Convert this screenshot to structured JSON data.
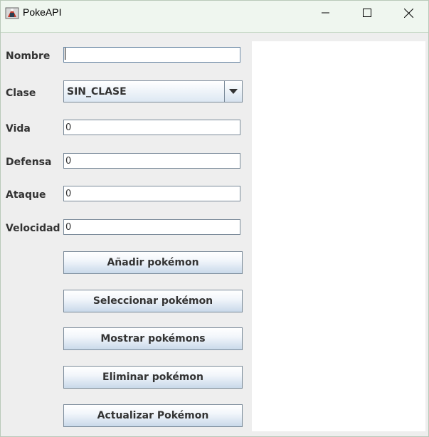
{
  "window": {
    "title": "PokeAPI",
    "icon": "java-app-icon"
  },
  "form": {
    "nombre": {
      "label": "Nombre",
      "value": ""
    },
    "clase": {
      "label": "Clase",
      "value": "SIN_CLASE"
    },
    "vida": {
      "label": "Vida",
      "value": "0"
    },
    "defensa": {
      "label": "Defensa",
      "value": "0"
    },
    "ataque": {
      "label": "Ataque",
      "value": "0"
    },
    "velocidad": {
      "label": "Velocidad",
      "value": "0"
    }
  },
  "buttons": {
    "add": "Añadir pokémon",
    "select": "Seleccionar pokémon",
    "show": "Mostrar pokémons",
    "delete": "Eliminar pokémon",
    "update": "Actualizar Pokémon"
  },
  "colors": {
    "titlebar": "#eff6ef",
    "background": "#eeeeee",
    "panel": "#ffffff",
    "label_text": "#333333"
  }
}
